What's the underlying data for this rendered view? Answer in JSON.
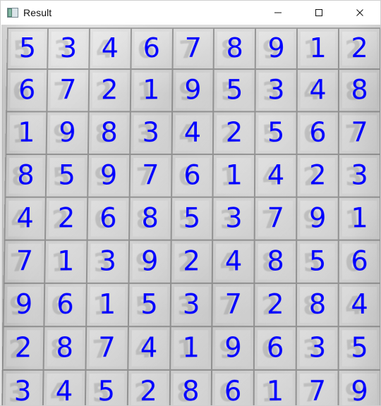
{
  "window": {
    "title": "Result",
    "icon": "window-app-icon",
    "controls": [
      {
        "name": "minimize",
        "icon": "minimize-icon"
      },
      {
        "name": "maximize",
        "icon": "maximize-icon"
      },
      {
        "name": "close",
        "icon": "close-icon"
      }
    ]
  },
  "colors": {
    "digit": "#0000ff",
    "grid": "#5f5f5f",
    "background": "#d0d0d0"
  },
  "sudoku": {
    "rows": [
      [
        "5",
        "3",
        "4",
        "6",
        "7",
        "8",
        "9",
        "1",
        "2"
      ],
      [
        "6",
        "7",
        "2",
        "1",
        "9",
        "5",
        "3",
        "4",
        "8"
      ],
      [
        "1",
        "9",
        "8",
        "3",
        "4",
        "2",
        "5",
        "6",
        "7"
      ],
      [
        "8",
        "5",
        "9",
        "7",
        "6",
        "1",
        "4",
        "2",
        "3"
      ],
      [
        "4",
        "2",
        "6",
        "8",
        "5",
        "3",
        "7",
        "9",
        "1"
      ],
      [
        "7",
        "1",
        "3",
        "9",
        "2",
        "4",
        "8",
        "5",
        "6"
      ],
      [
        "9",
        "6",
        "1",
        "5",
        "3",
        "7",
        "2",
        "8",
        "4"
      ],
      [
        "2",
        "8",
        "7",
        "4",
        "1",
        "9",
        "6",
        "3",
        "5"
      ],
      [
        "3",
        "4",
        "5",
        "2",
        "8",
        "6",
        "1",
        "7",
        "9"
      ]
    ]
  }
}
